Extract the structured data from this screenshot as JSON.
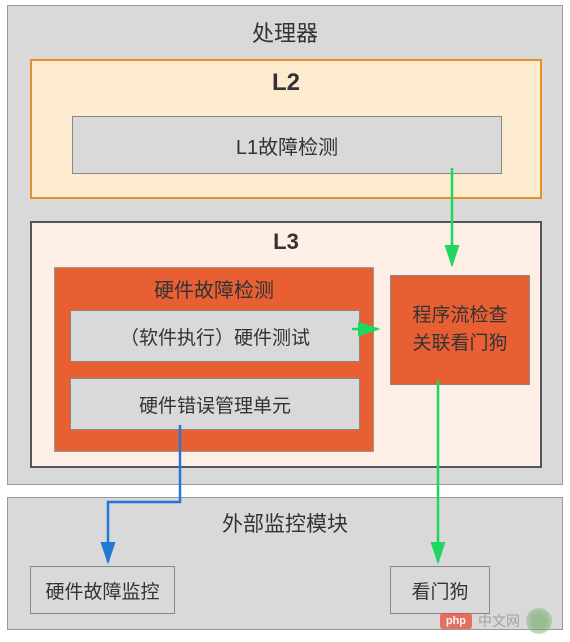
{
  "processor": {
    "title": "处理器",
    "l2": {
      "label": "L2",
      "l1_fault_detection": "L1故障检测"
    },
    "l3": {
      "label": "L3",
      "hw_fault_detection": {
        "title": "硬件故障检测",
        "sw_hw_test": "（软件执行）硬件测试",
        "hw_error_mgmt": "硬件错误管理单元"
      },
      "flow_check": {
        "line1": "程序流检查",
        "line2": "关联看门狗"
      }
    }
  },
  "external_monitor": {
    "title": "外部监控模块",
    "hw_fault_monitor": "硬件故障监控",
    "watchdog": "看门狗"
  },
  "arrows": {
    "color_green": "#1ed760",
    "color_blue": "#2079d6"
  },
  "watermark": {
    "php": "php",
    "text": "中文网"
  }
}
